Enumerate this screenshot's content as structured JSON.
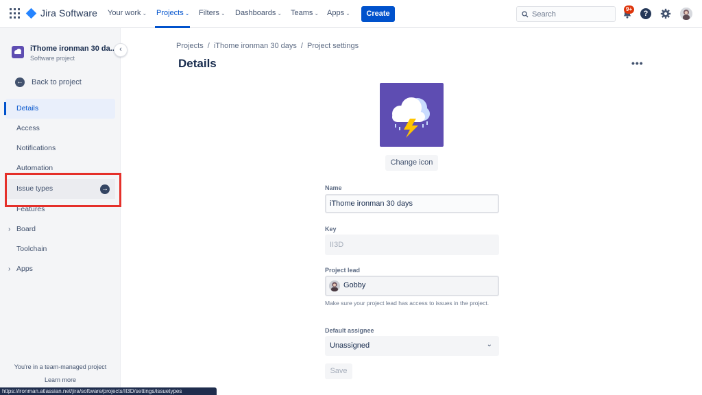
{
  "topnav": {
    "product": "Jira Software",
    "items": [
      {
        "label": "Your work"
      },
      {
        "label": "Projects"
      },
      {
        "label": "Filters"
      },
      {
        "label": "Dashboards"
      },
      {
        "label": "Teams"
      },
      {
        "label": "Apps"
      }
    ],
    "active_item": "Projects",
    "create_label": "Create",
    "search_placeholder": "Search",
    "notifications_badge": "9+",
    "help_glyph": "?",
    "icons": [
      "app-switcher-icon",
      "jira-logo-icon",
      "chevron-down-icon",
      "search-icon",
      "bell-icon",
      "help-icon",
      "gear-icon",
      "avatar"
    ]
  },
  "sidebar": {
    "project_name": "iThome ironman 30 da...",
    "project_type": "Software project",
    "back_label": "Back to project",
    "items": [
      {
        "label": "Details"
      },
      {
        "label": "Access"
      },
      {
        "label": "Notifications"
      },
      {
        "label": "Automation"
      },
      {
        "label": "Issue types"
      },
      {
        "label": "Features"
      },
      {
        "label": "Board"
      },
      {
        "label": "Toolchain"
      },
      {
        "label": "Apps"
      }
    ],
    "selected_item": "Details",
    "team_note": "You're in a team-managed project",
    "learn_more": "Learn more"
  },
  "status_url": "https://ironman.atlassian.net/jira/software/projects/II3D/settings/issuetypes",
  "main": {
    "breadcrumb": [
      "Projects",
      "iThome ironman 30 days",
      "Project settings"
    ],
    "breadcrumb_sep": "/",
    "title": "Details",
    "more_glyph": "•••",
    "change_icon_label": "Change icon",
    "name_label": "Name",
    "name_value": "iThome ironman 30 days",
    "key_label": "Key",
    "key_value": "II3D",
    "lead_label": "Project lead",
    "lead_value": "Gobby",
    "lead_helper": "Make sure your project lead has access to issues in the project.",
    "assignee_label": "Default assignee",
    "assignee_value": "Unassigned",
    "save_label": "Save"
  },
  "colors": {
    "brand": "#0052cc",
    "project_icon_bg": "#5e4db2",
    "highlight": "#e5302a"
  }
}
